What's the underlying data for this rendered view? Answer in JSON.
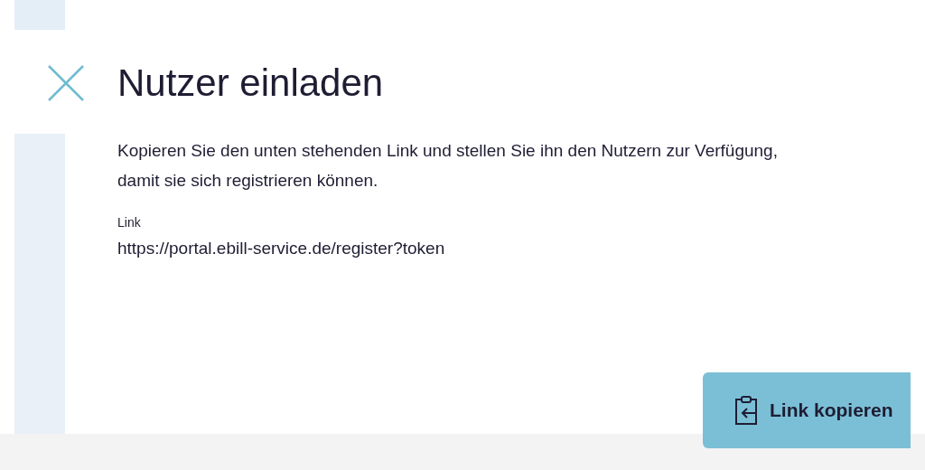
{
  "dialog": {
    "title": "Nutzer einladen",
    "description": "Kopieren Sie den unten stehenden Link und stellen Sie ihn den Nutzern zur Verfügung, damit sie sich registrieren können.",
    "link_label": "Link",
    "link_value": "https://portal.ebill-service.de/register?token",
    "copy_button": "Link kopieren"
  }
}
